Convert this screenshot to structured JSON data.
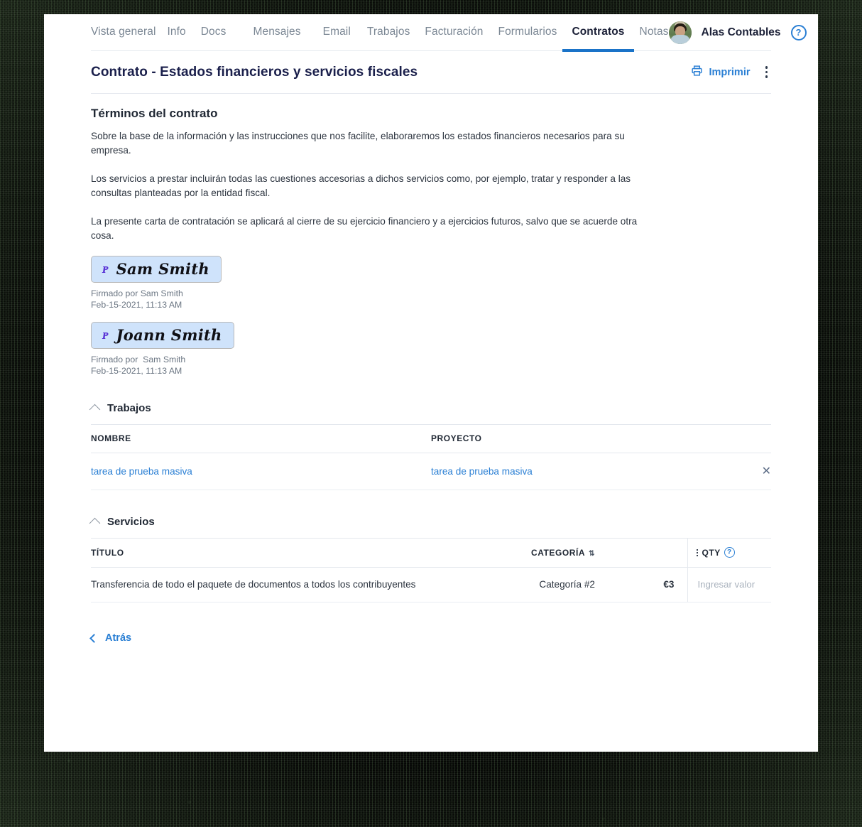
{
  "nav": {
    "items": [
      {
        "label": "Vista general",
        "active": false
      },
      {
        "label": "Info",
        "active": false
      },
      {
        "label": "Docs",
        "active": false
      },
      {
        "label": "Mensajes",
        "active": false
      },
      {
        "label": "Email",
        "active": false
      },
      {
        "label": "Trabajos",
        "active": false
      },
      {
        "label": "Facturación",
        "active": false
      },
      {
        "label": "Formularios",
        "active": false
      },
      {
        "label": "Contratos",
        "active": true
      },
      {
        "label": "Notas",
        "active": false
      }
    ],
    "user_name": "Alas Contables",
    "avatar_icon": "user-avatar-photo",
    "help_icon": "question-circle-icon",
    "help_glyph": "?"
  },
  "title_bar": {
    "title": "Contrato - Estados financieros y servicios fiscales",
    "print_label": "Imprimir",
    "print_icon": "printer-icon",
    "more_icon": "kebab-menu-icon"
  },
  "terms": {
    "heading": "Términos del contrato",
    "paragraphs": [
      "Sobre la base de la información y las instrucciones que nos facilite, elaboraremos los estados financieros necesarios para su empresa.",
      "Los servicios a prestar incluirán todas las cuestiones accesorias a dichos servicios como, por ejemplo, tratar y responder a las consultas planteadas por la entidad fiscal.",
      "La presente carta de contratación se aplicará al cierre de su ejercicio financiero y a ejercicios futuros, salvo que se acuerde otra cosa."
    ]
  },
  "signatures": [
    {
      "name": "Sam Smith",
      "mark_icon": "pen-stroke-icon",
      "mark_glyph": "ᴘ",
      "signed_by": "Firmado por Sam Smith",
      "signed_at": "Feb-15-2021, 11:13 AM"
    },
    {
      "name": "Joann Smith",
      "mark_icon": "pen-stroke-icon",
      "mark_glyph": "ᴘ",
      "signed_by": "Firmado por  Sam Smith",
      "signed_at": "Feb-15-2021, 11:13 AM"
    }
  ],
  "trabajos": {
    "section_title": "Trabajos",
    "collapse_icon": "chevron-up-icon",
    "columns": [
      "NOMBRE",
      "PROYECTO"
    ],
    "rows": [
      {
        "nombre": "tarea de prueba masiva",
        "proyecto": "tarea de prueba masiva",
        "remove_icon": "close-x-icon",
        "remove_glyph": "✕"
      }
    ]
  },
  "servicios": {
    "section_title": "Servicios",
    "collapse_icon": "chevron-up-icon",
    "columns": {
      "titulo": "TÍTULO",
      "categoria": "CATEGORÍA",
      "qty": "QTY"
    },
    "sort_icon": "sort-arrows-icon",
    "sort_glyph": "⇅",
    "qty_help_icon": "question-circle-icon",
    "qty_help_glyph": "?",
    "grip_icon": "column-drag-handle-icon",
    "rows": [
      {
        "titulo": "Transferencia de todo el paquete de documentos a todos los contribuyentes",
        "categoria": "Categoría #2",
        "precio": "€3",
        "qty_value": "",
        "qty_placeholder": "Ingresar valor"
      }
    ]
  },
  "footer": {
    "back_label": "Atrás",
    "back_icon": "chevron-left-icon"
  },
  "colors": {
    "accent_blue": "#2a7fd4",
    "active_tab_underline": "#1a73c8",
    "title_navy": "#1a1f4b",
    "muted_gray": "#7b8794",
    "signature_bg": "#cfe3fb",
    "signature_mark": "#5a34d6"
  }
}
